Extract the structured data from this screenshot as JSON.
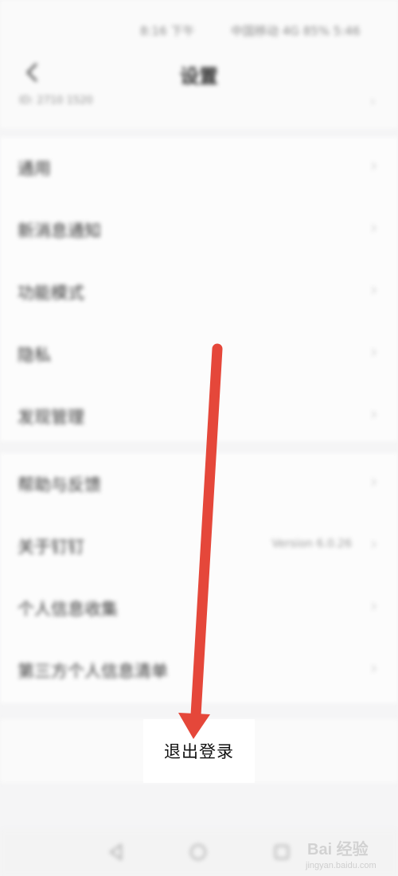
{
  "status_bar": {
    "left_text": "8:16 下午",
    "right_text": "中国移动 4G 85% 5:46"
  },
  "nav": {
    "title": "设置",
    "back_icon": "chevron-left-icon"
  },
  "sub_row": {
    "text": "ID: 2710 1520",
    "chevron": "›"
  },
  "group1": [
    {
      "label": "通用",
      "chevron": "›"
    },
    {
      "label": "新消息通知",
      "chevron": "›"
    },
    {
      "label": "功能模式",
      "chevron": "›"
    },
    {
      "label": "隐私",
      "chevron": "›"
    },
    {
      "label": "发现管理",
      "chevron": "›"
    }
  ],
  "group2": [
    {
      "label": "帮助与反馈",
      "chevron": "›",
      "value": ""
    },
    {
      "label": "关于钉钉",
      "chevron": "›",
      "value": "Version 6.0.26"
    },
    {
      "label": "个人信息收集",
      "chevron": "›",
      "value": ""
    },
    {
      "label": "第三方个人信息清单",
      "chevron": "›",
      "value": ""
    }
  ],
  "logout": {
    "label": "退出登录"
  },
  "bottom_nav": {
    "icons": [
      "back-triangle-icon",
      "home-circle-icon",
      "recents-square-icon"
    ]
  },
  "annotation": {
    "color": "#e5473a"
  },
  "watermark": {
    "brand": "Bai 经验",
    "url": "jingyan.baidu.com"
  }
}
